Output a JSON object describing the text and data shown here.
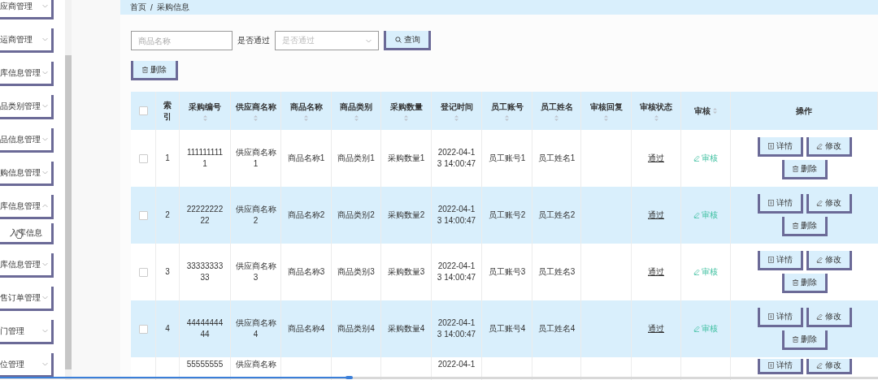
{
  "sidebar": {
    "items": [
      {
        "label": "应商管理",
        "expanded": false
      },
      {
        "label": "运商管理",
        "expanded": false
      },
      {
        "label": "库信息管理",
        "expanded": false
      },
      {
        "label": "品类别管理",
        "expanded": false
      },
      {
        "label": "品信息管理",
        "expanded": false
      },
      {
        "label": "购信息管理",
        "expanded": false
      },
      {
        "label": "库信息管理",
        "expanded": true,
        "children": [
          {
            "label": "入库信息"
          }
        ]
      },
      {
        "label": "库信息管理",
        "expanded": false
      },
      {
        "label": "售订单管理",
        "expanded": false
      },
      {
        "label": "门管理",
        "expanded": false
      },
      {
        "label": "位管理",
        "expanded": false
      }
    ]
  },
  "breadcrumb": {
    "items": [
      "首页",
      "采购信息"
    ],
    "separator": "/"
  },
  "search": {
    "name_placeholder": "商品名称",
    "pass_label": "是否通过",
    "pass_placeholder": "是否通过",
    "button": "查询"
  },
  "delete_button": "删除",
  "table": {
    "header_checked": false,
    "columns": [
      {
        "label": "索引",
        "sortable": false
      },
      {
        "label": "采购编号",
        "sortable": true
      },
      {
        "label": "供应商名称",
        "sortable": true
      },
      {
        "label": "商品名称",
        "sortable": true
      },
      {
        "label": "商品类别",
        "sortable": true
      },
      {
        "label": "采购数量",
        "sortable": true
      },
      {
        "label": "登记时间",
        "sortable": true
      },
      {
        "label": "员工账号",
        "sortable": true
      },
      {
        "label": "员工姓名",
        "sortable": true
      },
      {
        "label": "审核回复",
        "sortable": true
      },
      {
        "label": "审核状态",
        "sortable": true
      },
      {
        "label": "审核",
        "sortable": true,
        "inline_sort": true
      },
      {
        "label": "操作",
        "sortable": false
      }
    ],
    "rows": [
      {
        "kind": "full",
        "checked": false,
        "cells": [
          "1",
          "1111111111",
          "供应商名称1",
          "商品名称1",
          "商品类别1",
          "采购数量1",
          "2022-04-13 14:00:47",
          "员工账号1",
          "员工姓名1",
          "",
          "通过"
        ],
        "audit": "审核",
        "actions": [
          "详情",
          "修改",
          "删除"
        ]
      },
      {
        "kind": "full",
        "checked": false,
        "cells": [
          "2",
          "2222222222",
          "供应商名称2",
          "商品名称2",
          "商品类别2",
          "采购数量2",
          "2022-04-13 14:00:47",
          "员工账号2",
          "员工姓名2",
          "",
          "通过"
        ],
        "audit": "审核",
        "actions": [
          "详情",
          "修改",
          "删除"
        ]
      },
      {
        "kind": "full",
        "checked": false,
        "cells": [
          "3",
          "3333333333",
          "供应商名称3",
          "商品名称3",
          "商品类别3",
          "采购数量3",
          "2022-04-13 14:00:47",
          "员工账号3",
          "员工姓名3",
          "",
          "通过"
        ],
        "audit": "审核",
        "actions": [
          "详情",
          "修改",
          "删除"
        ]
      },
      {
        "kind": "full",
        "checked": false,
        "cells": [
          "4",
          "4444444444",
          "供应商名称4",
          "商品名称4",
          "商品类别4",
          "采购数量4",
          "2022-04-13 14:00:47",
          "员工账号4",
          "员工姓名4",
          "",
          "通过"
        ],
        "audit": "审核",
        "actions": [
          "详情",
          "修改",
          "删除"
        ]
      },
      {
        "kind": "partial",
        "cells": [
          "",
          "55555555",
          "供应商名称",
          "",
          "",
          "",
          "2022-04-1",
          "",
          "",
          "",
          ""
        ],
        "audit": "",
        "actions": [
          "详情",
          "修改"
        ]
      }
    ]
  }
}
